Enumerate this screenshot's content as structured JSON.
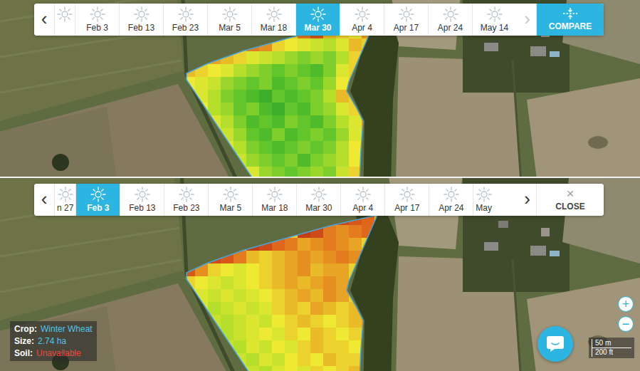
{
  "panels": [
    {
      "timeline": {
        "prev": {
          "label": "‹",
          "disabled": false
        },
        "next": {
          "label": "›",
          "disabled": true
        },
        "dates": [
          {
            "label": "",
            "selected": false,
            "cut": true
          },
          {
            "label": "Feb 3",
            "selected": false,
            "cut": false
          },
          {
            "label": "Feb 13",
            "selected": false,
            "cut": false
          },
          {
            "label": "Feb 23",
            "selected": false,
            "cut": false
          },
          {
            "label": "Mar 5",
            "selected": false,
            "cut": false
          },
          {
            "label": "Mar 18",
            "selected": false,
            "cut": false
          },
          {
            "label": "Mar 30",
            "selected": true,
            "cut": false
          },
          {
            "label": "Apr 4",
            "selected": false,
            "cut": false
          },
          {
            "label": "Apr 17",
            "selected": false,
            "cut": false
          },
          {
            "label": "Apr 24",
            "selected": false,
            "cut": false
          },
          {
            "label": "May 14",
            "selected": false,
            "cut": false
          }
        ],
        "action": {
          "kind": "compare",
          "icon": "",
          "label": "COMPARE"
        }
      },
      "field": {
        "ndvi": [
          [
            0.5,
            0.5,
            0.5,
            0.5,
            0.5,
            0.5,
            0.5,
            0.5,
            0.5,
            0.5,
            0.5,
            0.5,
            0.1,
            0.15,
            0.2,
            0.5
          ],
          [
            0.5,
            0.5,
            0.5,
            0.5,
            0.5,
            0.5,
            0.5,
            0.5,
            0.5,
            0.3,
            0.2,
            0.45,
            0.5,
            0.55,
            0.4,
            0.5
          ],
          [
            0.5,
            0.5,
            0.5,
            0.5,
            0.5,
            0.3,
            0.35,
            0.5,
            0.55,
            0.6,
            0.65,
            0.7,
            0.6,
            0.45,
            0.5,
            0.5
          ],
          [
            0.5,
            0.5,
            0.4,
            0.45,
            0.5,
            0.6,
            0.65,
            0.7,
            0.75,
            0.8,
            0.75,
            0.8,
            0.7,
            0.5,
            0.5,
            0.5
          ],
          [
            0.45,
            0.5,
            0.55,
            0.6,
            0.7,
            0.75,
            0.8,
            0.85,
            0.8,
            0.85,
            0.9,
            0.8,
            0.6,
            0.5,
            0.5,
            0.5
          ],
          [
            0.55,
            0.6,
            0.65,
            0.75,
            0.8,
            0.85,
            0.8,
            0.9,
            0.85,
            0.8,
            0.85,
            0.75,
            0.55,
            0.5,
            0.5,
            0.5
          ],
          [
            0.5,
            0.6,
            0.7,
            0.8,
            0.85,
            0.9,
            0.95,
            0.85,
            0.9,
            0.85,
            0.8,
            0.7,
            0.45,
            0.5,
            0.5,
            0.5
          ],
          [
            0.5,
            0.55,
            0.7,
            0.75,
            0.85,
            0.8,
            0.9,
            0.95,
            0.85,
            0.9,
            0.8,
            0.75,
            0.6,
            0.5,
            0.5,
            0.5
          ],
          [
            0.5,
            0.5,
            0.6,
            0.7,
            0.8,
            0.9,
            0.85,
            0.9,
            0.8,
            0.85,
            0.9,
            0.8,
            0.7,
            0.6,
            0.4,
            0.5
          ],
          [
            0.5,
            0.5,
            0.5,
            0.65,
            0.75,
            0.85,
            0.9,
            0.8,
            0.9,
            0.85,
            0.8,
            0.85,
            0.75,
            0.6,
            0.35,
            0.5
          ],
          [
            0.5,
            0.5,
            0.5,
            0.6,
            0.7,
            0.8,
            0.85,
            0.9,
            0.85,
            0.8,
            0.85,
            0.8,
            0.7,
            0.55,
            0.3,
            0.5
          ],
          [
            0.5,
            0.5,
            0.5,
            0.5,
            0.65,
            0.75,
            0.8,
            0.85,
            0.8,
            0.9,
            0.8,
            0.75,
            0.7,
            0.55,
            0.35,
            0.5
          ],
          [
            0.5,
            0.5,
            0.5,
            0.5,
            0.5,
            0.6,
            0.75,
            0.8,
            0.85,
            0.8,
            0.75,
            0.8,
            0.65,
            0.5,
            0.4,
            0.5
          ]
        ]
      }
    },
    {
      "timeline": {
        "prev": {
          "label": "‹",
          "disabled": false
        },
        "next": {
          "label": "›",
          "disabled": false
        },
        "dates": [
          {
            "label": "n 27",
            "selected": false,
            "cut": true
          },
          {
            "label": "Feb 3",
            "selected": true,
            "cut": false
          },
          {
            "label": "Feb 13",
            "selected": false,
            "cut": false
          },
          {
            "label": "Feb 23",
            "selected": false,
            "cut": false
          },
          {
            "label": "Mar 5",
            "selected": false,
            "cut": false
          },
          {
            "label": "Mar 18",
            "selected": false,
            "cut": false
          },
          {
            "label": "Mar 30",
            "selected": false,
            "cut": false
          },
          {
            "label": "Apr 4",
            "selected": false,
            "cut": false
          },
          {
            "label": "Apr 17",
            "selected": false,
            "cut": false
          },
          {
            "label": "Apr 24",
            "selected": false,
            "cut": false
          },
          {
            "label": "May",
            "selected": false,
            "cut": true
          }
        ],
        "action": {
          "kind": "close",
          "icon": "×",
          "label": "CLOSE"
        }
      },
      "field": {
        "ndvi": [
          [
            0.5,
            0.5,
            0.5,
            0.5,
            0.5,
            0.5,
            0.5,
            0.5,
            0.5,
            0.5,
            0.5,
            0.5,
            0.15,
            0.2,
            0.25,
            0.5
          ],
          [
            0.5,
            0.5,
            0.5,
            0.5,
            0.5,
            0.5,
            0.5,
            0.5,
            0.5,
            0.1,
            0.15,
            0.3,
            0.35,
            0.3,
            0.25,
            0.5
          ],
          [
            0.5,
            0.5,
            0.5,
            0.5,
            0.5,
            0.1,
            0.15,
            0.25,
            0.3,
            0.4,
            0.35,
            0.3,
            0.35,
            0.4,
            0.5,
            0.5
          ],
          [
            0.5,
            0.5,
            0.15,
            0.2,
            0.3,
            0.45,
            0.5,
            0.45,
            0.4,
            0.35,
            0.4,
            0.35,
            0.3,
            0.35,
            0.5,
            0.5
          ],
          [
            0.2,
            0.35,
            0.5,
            0.55,
            0.6,
            0.55,
            0.5,
            0.45,
            0.4,
            0.35,
            0.45,
            0.4,
            0.4,
            0.5,
            0.5,
            0.5
          ],
          [
            0.5,
            0.55,
            0.6,
            0.65,
            0.6,
            0.55,
            0.5,
            0.45,
            0.4,
            0.45,
            0.4,
            0.35,
            0.4,
            0.5,
            0.5,
            0.5
          ],
          [
            0.55,
            0.6,
            0.65,
            0.6,
            0.65,
            0.6,
            0.55,
            0.5,
            0.45,
            0.4,
            0.45,
            0.35,
            0.4,
            0.5,
            0.5,
            0.5
          ],
          [
            0.5,
            0.6,
            0.7,
            0.65,
            0.6,
            0.65,
            0.6,
            0.5,
            0.45,
            0.5,
            0.4,
            0.45,
            0.5,
            0.45,
            0.5,
            0.5
          ],
          [
            0.5,
            0.55,
            0.65,
            0.7,
            0.65,
            0.6,
            0.65,
            0.55,
            0.5,
            0.45,
            0.5,
            0.55,
            0.5,
            0.45,
            0.4,
            0.5
          ],
          [
            0.5,
            0.5,
            0.6,
            0.7,
            0.65,
            0.6,
            0.55,
            0.6,
            0.5,
            0.55,
            0.45,
            0.5,
            0.55,
            0.5,
            0.45,
            0.5
          ],
          [
            0.5,
            0.5,
            0.5,
            0.65,
            0.7,
            0.6,
            0.65,
            0.55,
            0.6,
            0.5,
            0.45,
            0.5,
            0.5,
            0.55,
            0.45,
            0.5
          ],
          [
            0.5,
            0.5,
            0.5,
            0.6,
            0.65,
            0.7,
            0.6,
            0.65,
            0.55,
            0.5,
            0.55,
            0.45,
            0.5,
            0.5,
            0.5,
            0.5
          ],
          [
            0.5,
            0.5,
            0.5,
            0.5,
            0.6,
            0.65,
            0.7,
            0.6,
            0.55,
            0.6,
            0.5,
            0.55,
            0.5,
            0.45,
            0.5,
            0.5
          ]
        ]
      },
      "overlay": {
        "field_info": [
          {
            "label": "Crop:",
            "value": "Winter Wheat",
            "available": true
          },
          {
            "label": "Size:",
            "value": "2.74 ha",
            "available": true
          },
          {
            "label": "Soil:",
            "value": "Unavailable",
            "available": false
          }
        ],
        "zoom": [
          "+",
          "−"
        ],
        "scale": {
          "metric": "50 m",
          "imperial": "200 ft"
        }
      }
    }
  ]
}
